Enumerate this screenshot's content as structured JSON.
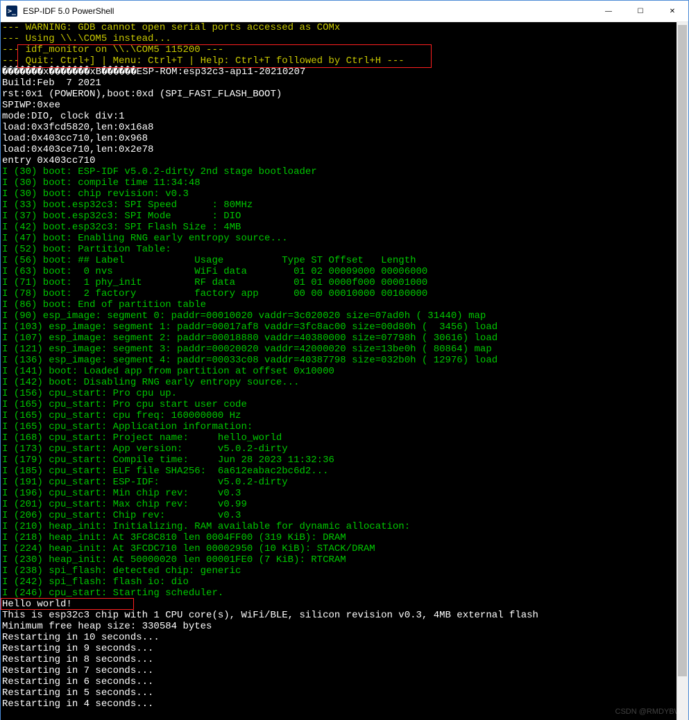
{
  "window": {
    "title": "ESP-IDF 5.0 PowerShell",
    "icon_glyph": ">_"
  },
  "controls": {
    "min": "—",
    "max": "☐",
    "close": "✕"
  },
  "annotations": {
    "box1_target": "monitor-help-lines",
    "box2_target": "hello-world-line"
  },
  "watermark": "CSDN @RMDYBW",
  "lines": [
    {
      "style": "y",
      "text": "--- WARNING: GDB cannot open serial ports accessed as COMx"
    },
    {
      "style": "y",
      "text": "--- Using \\\\.\\COM5 instead..."
    },
    {
      "style": "y",
      "text": "--- idf_monitor on \\\\.\\COM5 115200 ---"
    },
    {
      "style": "y",
      "text": "--- Quit: Ctrl+] | Menu: Ctrl+T | Help: Ctrl+T followed by Ctrl+H ---"
    },
    {
      "style": "w",
      "text": "�������x�������xB������ESP-ROM:esp32c3-api1-20210207"
    },
    {
      "style": "w",
      "text": "Build:Feb  7 2021"
    },
    {
      "style": "w",
      "text": "rst:0x1 (POWERON),boot:0xd (SPI_FAST_FLASH_BOOT)"
    },
    {
      "style": "w",
      "text": "SPIWP:0xee"
    },
    {
      "style": "w",
      "text": "mode:DIO, clock div:1"
    },
    {
      "style": "w",
      "text": "load:0x3fcd5820,len:0x16a8"
    },
    {
      "style": "w",
      "text": "load:0x403cc710,len:0x968"
    },
    {
      "style": "w",
      "text": "load:0x403ce710,len:0x2e78"
    },
    {
      "style": "w",
      "text": "entry 0x403cc710"
    },
    {
      "style": "g",
      "text": "I (30) boot: ESP-IDF v5.0.2-dirty 2nd stage bootloader"
    },
    {
      "style": "g",
      "text": "I (30) boot: compile time 11:34:48"
    },
    {
      "style": "g",
      "text": "I (30) boot: chip revision: v0.3"
    },
    {
      "style": "g",
      "text": "I (33) boot.esp32c3: SPI Speed      : 80MHz"
    },
    {
      "style": "g",
      "text": "I (37) boot.esp32c3: SPI Mode       : DIO"
    },
    {
      "style": "g",
      "text": "I (42) boot.esp32c3: SPI Flash Size : 4MB"
    },
    {
      "style": "g",
      "text": "I (47) boot: Enabling RNG early entropy source..."
    },
    {
      "style": "g",
      "text": "I (52) boot: Partition Table:"
    },
    {
      "style": "g",
      "text": "I (56) boot: ## Label            Usage          Type ST Offset   Length"
    },
    {
      "style": "g",
      "text": "I (63) boot:  0 nvs              WiFi data        01 02 00009000 00006000"
    },
    {
      "style": "g",
      "text": "I (71) boot:  1 phy_init         RF data          01 01 0000f000 00001000"
    },
    {
      "style": "g",
      "text": "I (78) boot:  2 factory          factory app      00 00 00010000 00100000"
    },
    {
      "style": "g",
      "text": "I (86) boot: End of partition table"
    },
    {
      "style": "g",
      "text": "I (90) esp_image: segment 0: paddr=00010020 vaddr=3c020020 size=07ad0h ( 31440) map"
    },
    {
      "style": "g",
      "text": "I (103) esp_image: segment 1: paddr=00017af8 vaddr=3fc8ac00 size=00d80h (  3456) load"
    },
    {
      "style": "g",
      "text": "I (107) esp_image: segment 2: paddr=00018880 vaddr=40380000 size=07798h ( 30616) load"
    },
    {
      "style": "g",
      "text": "I (121) esp_image: segment 3: paddr=00020020 vaddr=42000020 size=13be0h ( 80864) map"
    },
    {
      "style": "g",
      "text": "I (136) esp_image: segment 4: paddr=00033c08 vaddr=40387798 size=032b0h ( 12976) load"
    },
    {
      "style": "g",
      "text": "I (141) boot: Loaded app from partition at offset 0x10000"
    },
    {
      "style": "g",
      "text": "I (142) boot: Disabling RNG early entropy source..."
    },
    {
      "style": "g",
      "text": "I (156) cpu_start: Pro cpu up."
    },
    {
      "style": "g",
      "text": "I (165) cpu_start: Pro cpu start user code"
    },
    {
      "style": "g",
      "text": "I (165) cpu_start: cpu freq: 160000000 Hz"
    },
    {
      "style": "g",
      "text": "I (165) cpu_start: Application information:"
    },
    {
      "style": "g",
      "text": "I (168) cpu_start: Project name:     hello_world"
    },
    {
      "style": "g",
      "text": "I (173) cpu_start: App version:      v5.0.2-dirty"
    },
    {
      "style": "g",
      "text": "I (179) cpu_start: Compile time:     Jun 28 2023 11:32:36"
    },
    {
      "style": "g",
      "text": "I (185) cpu_start: ELF file SHA256:  6a612eabac2bc6d2..."
    },
    {
      "style": "g",
      "text": "I (191) cpu_start: ESP-IDF:          v5.0.2-dirty"
    },
    {
      "style": "g",
      "text": "I (196) cpu_start: Min chip rev:     v0.3"
    },
    {
      "style": "g",
      "text": "I (201) cpu_start: Max chip rev:     v0.99 "
    },
    {
      "style": "g",
      "text": "I (206) cpu_start: Chip rev:         v0.3"
    },
    {
      "style": "g",
      "text": "I (210) heap_init: Initializing. RAM available for dynamic allocation:"
    },
    {
      "style": "g",
      "text": "I (218) heap_init: At 3FC8C810 len 0004FF00 (319 KiB): DRAM"
    },
    {
      "style": "g",
      "text": "I (224) heap_init: At 3FCDC710 len 00002950 (10 KiB): STACK/DRAM"
    },
    {
      "style": "g",
      "text": "I (230) heap_init: At 50000020 len 00001FE0 (7 KiB): RTCRAM"
    },
    {
      "style": "g",
      "text": "I (238) spi_flash: detected chip: generic"
    },
    {
      "style": "g",
      "text": "I (242) spi_flash: flash io: dio"
    },
    {
      "style": "g",
      "text": "I (246) cpu_start: Starting scheduler."
    },
    {
      "style": "w",
      "text": "Hello world!"
    },
    {
      "style": "w",
      "text": "This is esp32c3 chip with 1 CPU core(s), WiFi/BLE, silicon revision v0.3, 4MB external flash"
    },
    {
      "style": "w",
      "text": "Minimum free heap size: 330584 bytes"
    },
    {
      "style": "w",
      "text": "Restarting in 10 seconds..."
    },
    {
      "style": "w",
      "text": "Restarting in 9 seconds..."
    },
    {
      "style": "w",
      "text": "Restarting in 8 seconds..."
    },
    {
      "style": "w",
      "text": "Restarting in 7 seconds..."
    },
    {
      "style": "w",
      "text": "Restarting in 6 seconds..."
    },
    {
      "style": "w",
      "text": "Restarting in 5 seconds..."
    },
    {
      "style": "w",
      "text": "Restarting in 4 seconds..."
    }
  ]
}
